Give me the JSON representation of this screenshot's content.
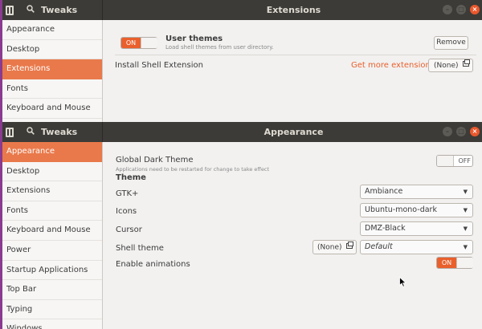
{
  "window1": {
    "app_title": "Tweaks",
    "title": "Extensions",
    "sidebar": [
      "Appearance",
      "Desktop",
      "Extensions",
      "Fonts",
      "Keyboard and Mouse"
    ],
    "active_index": 2,
    "user_themes": {
      "toggle_label": "ON",
      "title": "User themes",
      "subtitle": "Load shell themes from user directory.",
      "remove_label": "Remove"
    },
    "install": {
      "label": "Install Shell Extension",
      "link": "Get more extensions",
      "file_button": "(None)"
    }
  },
  "window2": {
    "app_title": "Tweaks",
    "title": "Appearance",
    "sidebar": [
      "Appearance",
      "Desktop",
      "Extensions",
      "Fonts",
      "Keyboard and Mouse",
      "Power",
      "Startup Applications",
      "Top Bar",
      "Typing",
      "Windows"
    ],
    "active_index": 0,
    "dark_theme": {
      "label": "Global Dark Theme",
      "subtitle": "Applications need to be restarted for change to take effect",
      "toggle_label": "OFF"
    },
    "theme_heading": "Theme",
    "rows": {
      "gtk": {
        "label": "GTK+",
        "value": "Ambiance"
      },
      "icons": {
        "label": "Icons",
        "value": "Ubuntu-mono-dark"
      },
      "cursor": {
        "label": "Cursor",
        "value": "DMZ-Black"
      },
      "shell": {
        "label": "Shell theme",
        "file_button": "(None)",
        "value": "Default"
      }
    },
    "animations": {
      "label": "Enable animations",
      "toggle_label": "ON"
    }
  },
  "colors": {
    "accent": "#e9794b",
    "titlebar": "#3c3b37",
    "close": "#e9582d"
  }
}
